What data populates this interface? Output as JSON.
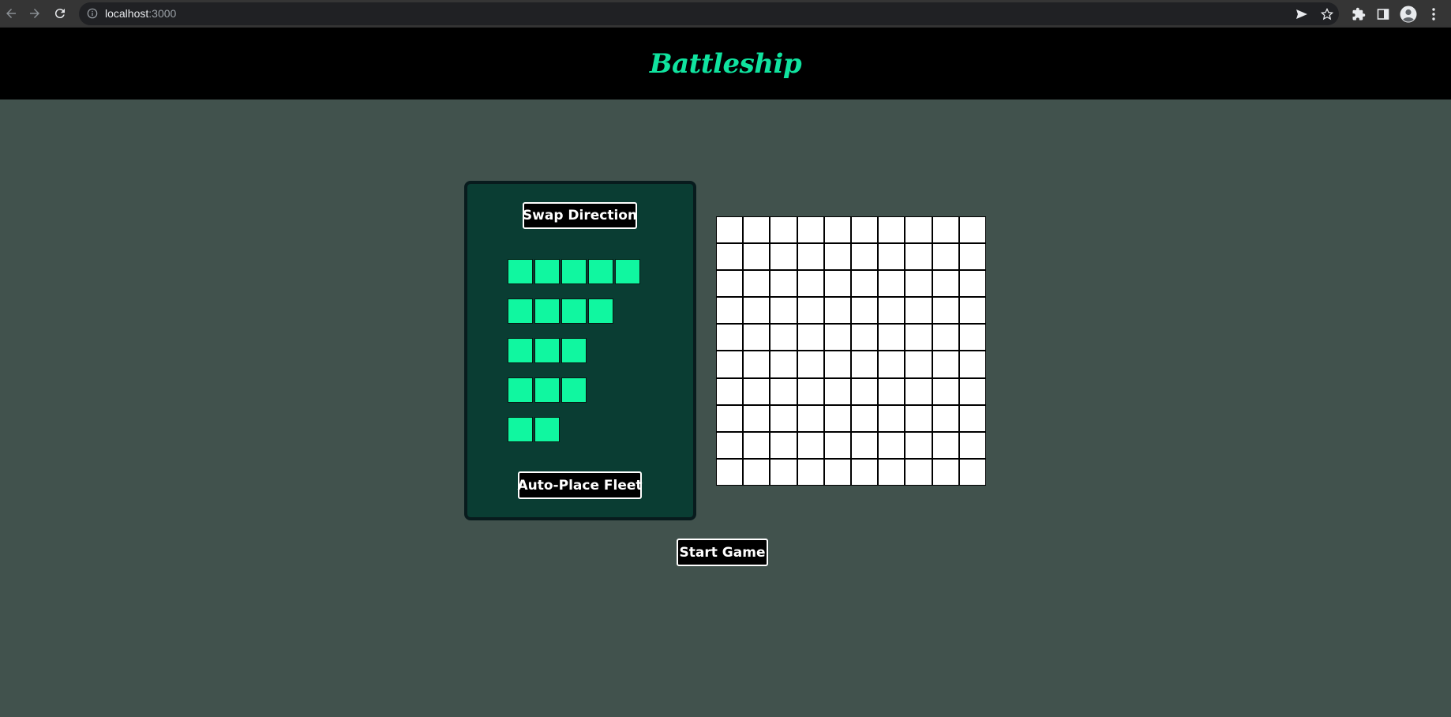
{
  "browser": {
    "url_host": "localhost",
    "url_port": ":3000"
  },
  "app": {
    "title": "Battleship",
    "accent_color": "#10e39f"
  },
  "fleet_panel": {
    "swap_label": "Swap Direction",
    "auto_place_label": "Auto-Place Fleet",
    "ships": [
      {
        "length": 5
      },
      {
        "length": 4
      },
      {
        "length": 3
      },
      {
        "length": 3
      },
      {
        "length": 2
      }
    ]
  },
  "board": {
    "rows": 10,
    "cols": 10
  },
  "start_label": "Start Game"
}
